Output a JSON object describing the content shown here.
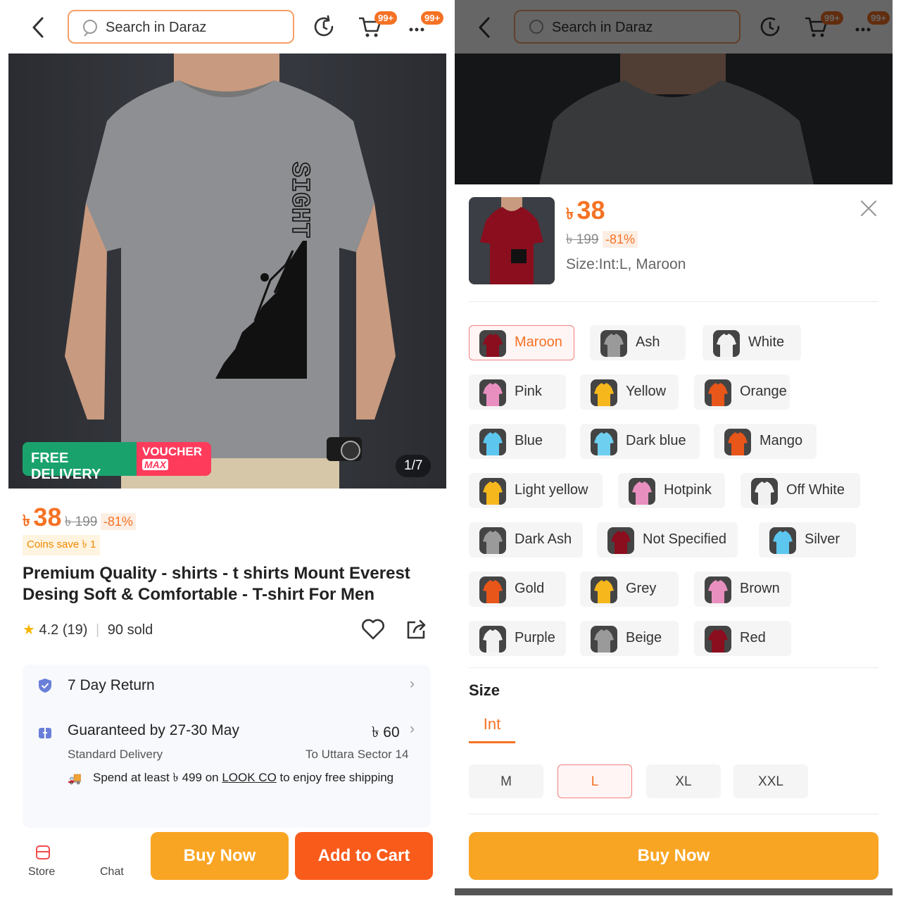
{
  "search": {
    "placeholder": "Search in Daraz"
  },
  "badges": {
    "cart": "99+",
    "more": "99+"
  },
  "product": {
    "image_counter": "1/7",
    "free_delivery": "FREE DELIVERY",
    "voucher_label": "VOUCHER",
    "voucher_sub": "MAX",
    "tshirt_print": "SIGHT",
    "currency": "৳",
    "price": "38",
    "old_price": "৳ 199",
    "discount": "-81%",
    "coins": "Coins save ৳ 1",
    "title": "Premium Quality - shirts - t shirts  Mount Everest Desing Soft & Comfortable - T-shirt For Men",
    "rating": "4.2",
    "rating_count": "(19)",
    "sold": "90 sold",
    "colors": {
      "accent": "#f57224",
      "buy": "#f9a524",
      "cart": "#f95b1b"
    }
  },
  "services": {
    "return": "7 Day Return",
    "guarantee": "Guaranteed by 27-30 May",
    "fee": "৳ 60",
    "delivery": "Standard Delivery",
    "destination": "To Uttara Sector 14",
    "promo_prefix": "Spend at least ৳ 499 on ",
    "promo_shop": "LOOK CO",
    "promo_suffix": " to enjoy free shipping"
  },
  "bottom": {
    "store": "Store",
    "chat": "Chat",
    "buy_now": "Buy Now",
    "add_to_cart": "Add to Cart"
  },
  "sheet": {
    "price": "38",
    "old_price": "৳ 199",
    "discount": "-81%",
    "selection": "Size:Int:L, Maroon",
    "size_title": "Size",
    "size_tab": "Int",
    "buy_now": "Buy Now",
    "colors": [
      {
        "label": "Maroon",
        "swatch": "#8a0e1e",
        "selected": true
      },
      {
        "label": "Ash",
        "swatch": "#9a9a9a"
      },
      {
        "label": "White",
        "swatch": "#f1f1f1"
      },
      {
        "label": "Pink",
        "swatch": "#e88fbf"
      },
      {
        "label": "Yellow",
        "swatch": "#f5b71c"
      },
      {
        "label": "Orange",
        "swatch": "#e8561a"
      },
      {
        "label": "Blue",
        "swatch": "#5cc6ee"
      },
      {
        "label": "Dark blue",
        "swatch": "#6fcff0"
      },
      {
        "label": "Mango",
        "swatch": "#e8561a"
      },
      {
        "label": "Light yellow",
        "swatch": "#f5b71c"
      },
      {
        "label": "Hotpink",
        "swatch": "#e88fbf"
      },
      {
        "label": "Off White",
        "swatch": "#f1f1f1"
      },
      {
        "label": "Dark Ash",
        "swatch": "#9a9a9a"
      },
      {
        "label": "Not Specified",
        "swatch": "#8a0e1e"
      },
      {
        "label": "Silver",
        "swatch": "#5cc6ee"
      },
      {
        "label": "Gold",
        "swatch": "#e8561a"
      },
      {
        "label": "Grey",
        "swatch": "#f5b71c"
      },
      {
        "label": "Brown",
        "swatch": "#e88fbf"
      },
      {
        "label": "Purple",
        "swatch": "#f1f1f1"
      },
      {
        "label": "Beige",
        "swatch": "#9a9a9a"
      },
      {
        "label": "Red",
        "swatch": "#8a0e1e"
      }
    ],
    "sizes": [
      {
        "label": "M"
      },
      {
        "label": "L",
        "selected": true
      },
      {
        "label": "XL"
      },
      {
        "label": "XXL"
      }
    ]
  }
}
